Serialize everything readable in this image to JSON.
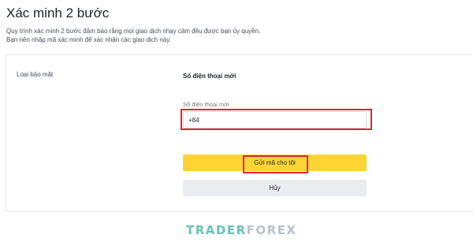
{
  "page": {
    "title": "Xác minh 2 bước",
    "description_line1": "Quy trình xác minh 2 bước đảm bảo rằng mọi giao dịch nhạy cảm đều được bạn ủy quyền.",
    "description_line2": "Bạn nên nhập mã xác minh để xác nhận các giao dịch này."
  },
  "security": {
    "type_label": "Loại bảo mật",
    "section_heading": "Số điện thoại mới",
    "phone_label": "Số điện thoại mới",
    "phone_value": "+84",
    "send_code_label": "Gửi mã cho tôi",
    "cancel_label": "Hủy"
  },
  "watermark": {
    "part1": "TRADER",
    "part2": "FOREX"
  },
  "colors": {
    "accent": "#fcd535",
    "highlight": "#e0262d",
    "cancel_bg": "#eaecef"
  }
}
